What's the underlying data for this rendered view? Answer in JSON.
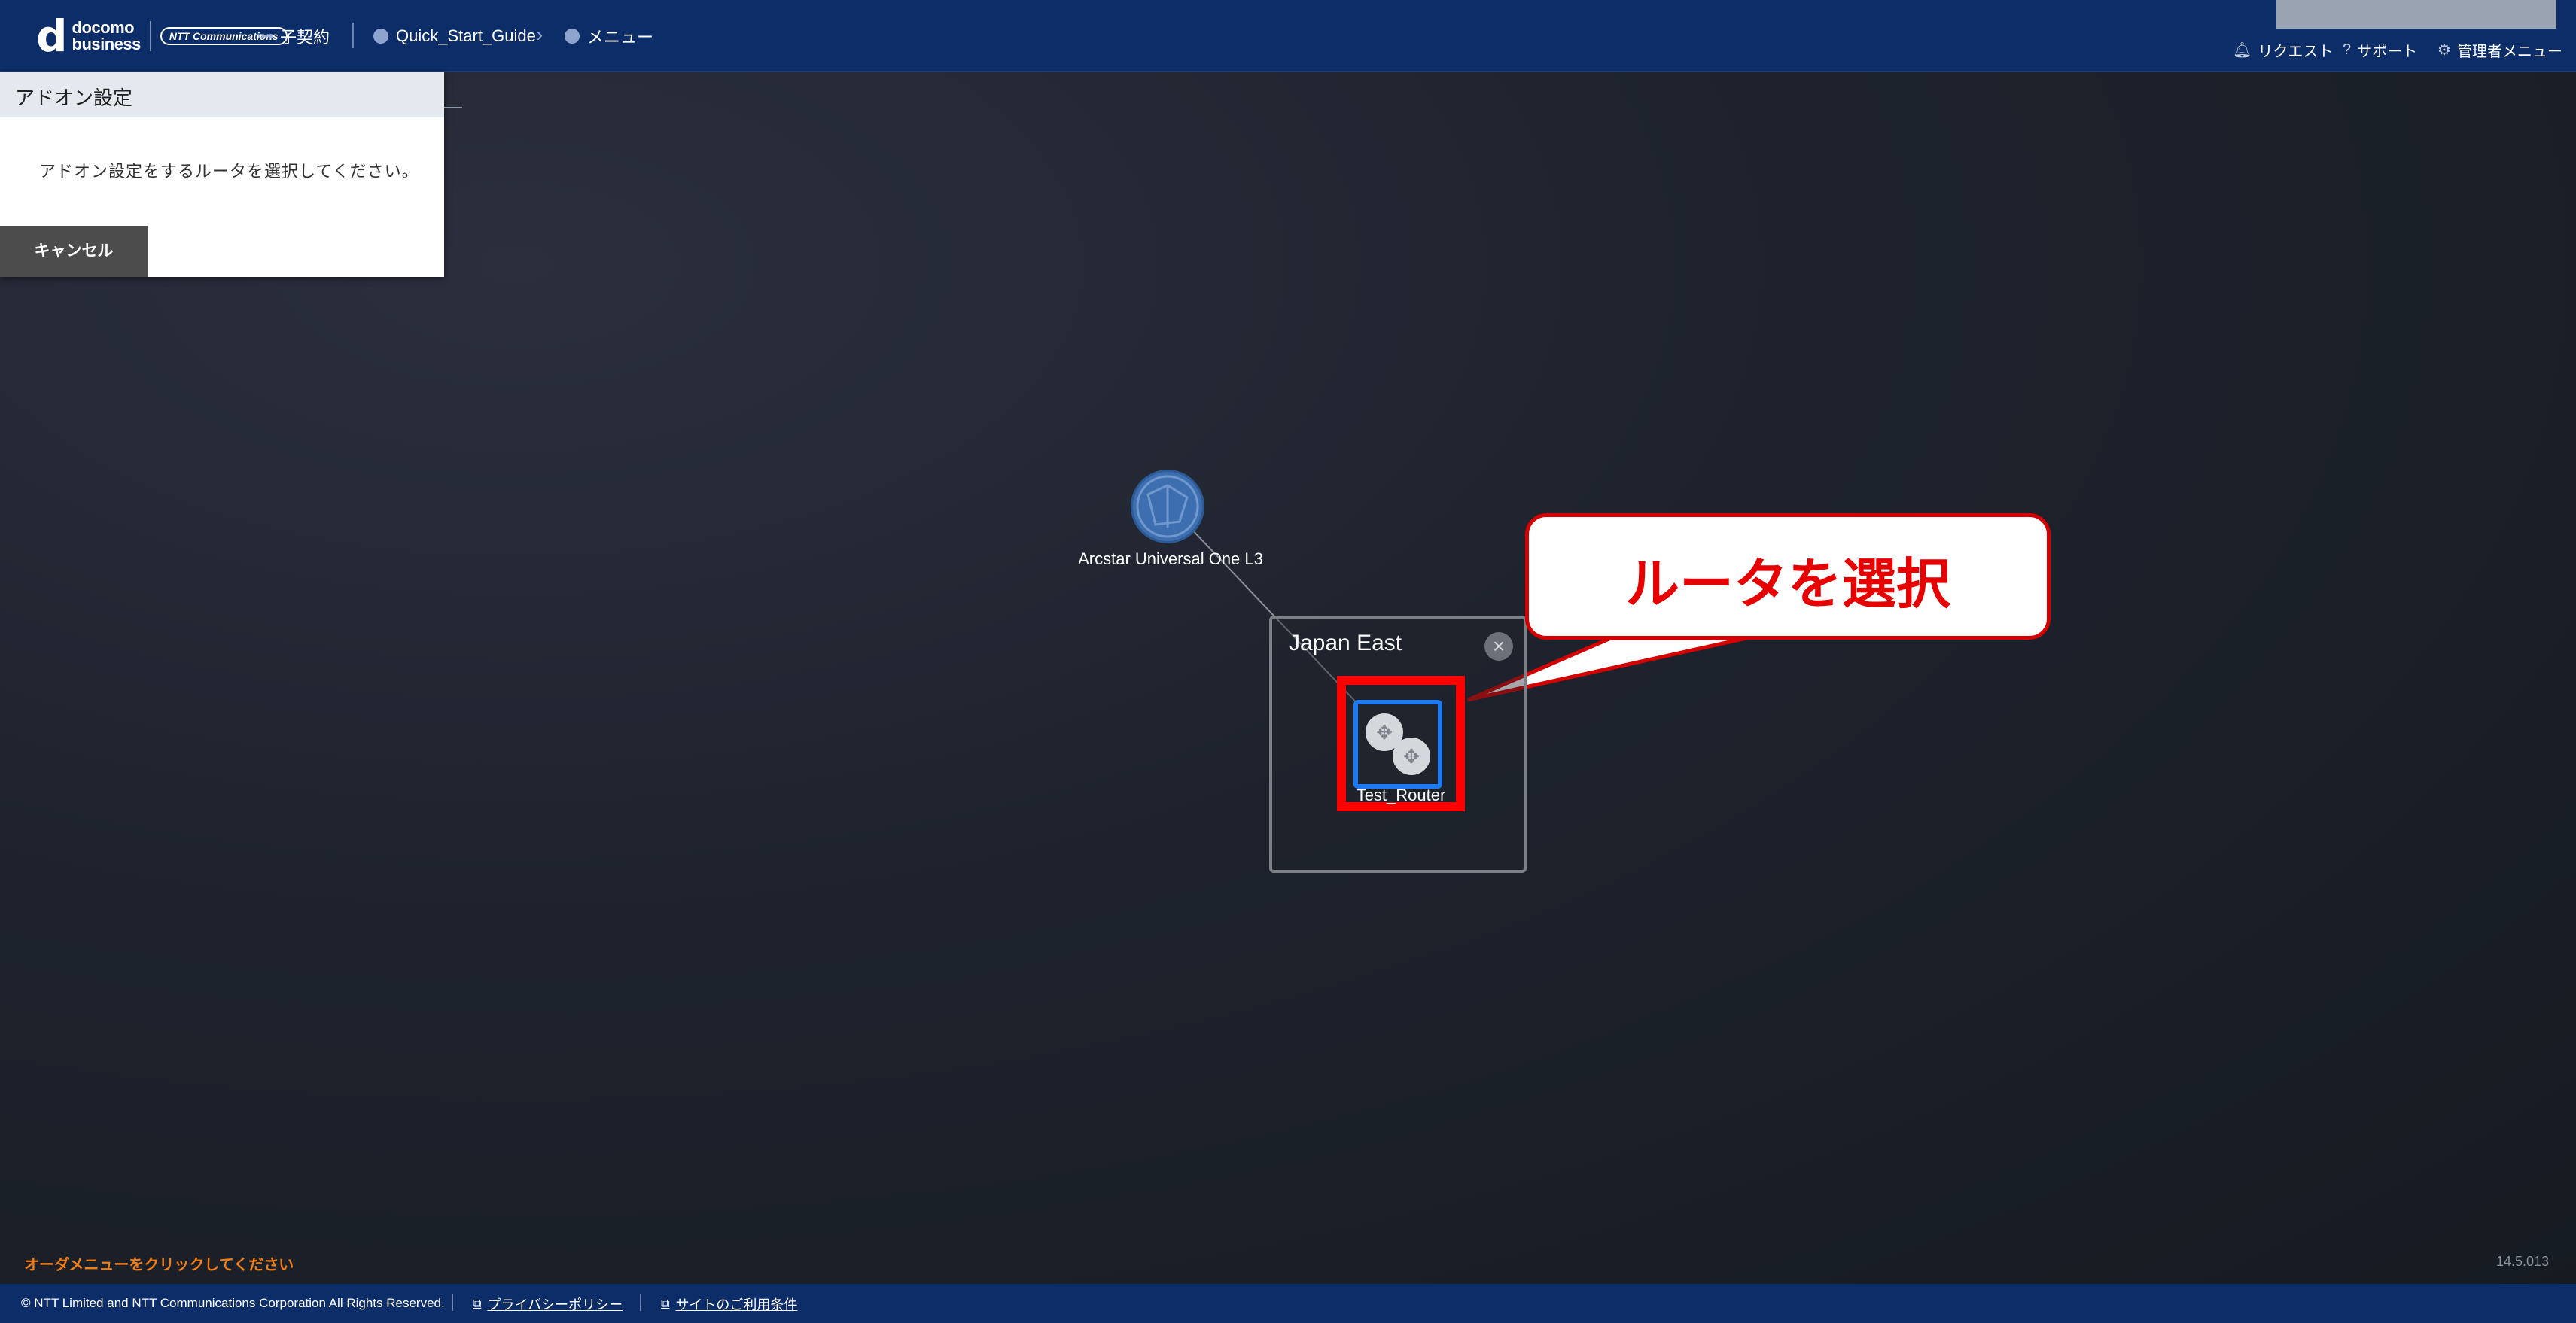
{
  "header": {
    "logo_top": "docomo",
    "logo_bottom": "business",
    "ntt_logo": "NTT Communications",
    "contract_label": "子契約",
    "breadcrumb_guide": "Quick_Start_Guide",
    "breadcrumb_menu": "メニュー",
    "request_label": "リクエスト",
    "support_label": "サポート",
    "admin_menu_label": "管理者メニュー"
  },
  "panel": {
    "title": "アドオン設定",
    "message": "アドオン設定をするルータを選択してください。",
    "cancel_label": "キャンセル"
  },
  "canvas": {
    "network_label": "Arcstar Universal One L3",
    "region_title": "Japan East",
    "router_label": "Test_Router",
    "callout_text": "ルータを選択",
    "highlight_color": "#ff0000",
    "router_border_color": "#1d7af2"
  },
  "status": {
    "order_hint": "オーダメニューをクリックしてください",
    "version": "14.5.013"
  },
  "footer": {
    "copyright": "© NTT Limited and NTT Communications Corporation All Rights Reserved.",
    "privacy_link": "プライバシーポリシー",
    "terms_link": "サイトのご利用条件"
  }
}
